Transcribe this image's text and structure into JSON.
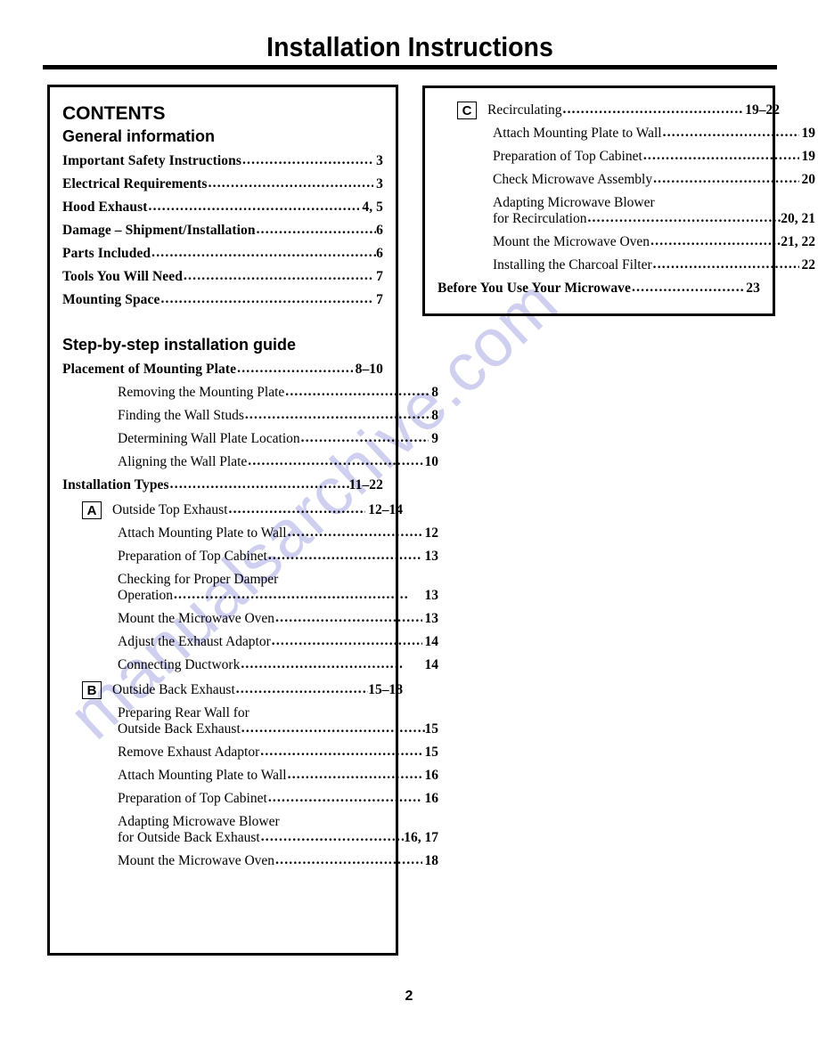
{
  "document": {
    "title": "Installation Instructions",
    "page_number": "2",
    "watermark": "manualsarchive.com"
  },
  "left_column": {
    "contents_heading": "CONTENTS",
    "general_information": {
      "heading": "General information",
      "entries": [
        {
          "label": "Important Safety Instructions",
          "page": "3"
        },
        {
          "label": "Electrical Requirements",
          "page": "3"
        },
        {
          "label": "Hood Exhaust",
          "page": "4, 5"
        },
        {
          "label": "Damage – Shipment/Installation",
          "page": "6"
        },
        {
          "label": "Parts Included",
          "page": "6"
        },
        {
          "label": "Tools You Will Need",
          "page": "7"
        },
        {
          "label": "Mounting Space",
          "page": "7"
        }
      ]
    },
    "step_by_step": {
      "heading": "Step-by-step installation guide",
      "placement": {
        "label": "Placement of Mounting Plate",
        "page": "8–10"
      },
      "placement_subentries": [
        {
          "label": "Removing the Mounting Plate",
          "page": "8"
        },
        {
          "label": "Finding the Wall Studs",
          "page": "8"
        },
        {
          "label": "Determining Wall Plate Location",
          "page": "9"
        },
        {
          "label": "Aligning the Wall Plate",
          "page": "10"
        }
      ],
      "installation_types": {
        "label": "Installation Types",
        "page": "11–22"
      },
      "type_a": {
        "badge": "A",
        "label": "Outside Top Exhaust",
        "page": "12–14",
        "subentries": [
          {
            "label": "Attach Mounting Plate to Wall",
            "page": "12"
          },
          {
            "label": "Preparation of Top Cabinet",
            "page": "13"
          },
          {
            "label_line1": "Checking for Proper Damper",
            "label": "Operation",
            "page": "13"
          },
          {
            "label": "Mount the Microwave Oven",
            "page": "13"
          },
          {
            "label": "Adjust the Exhaust Adaptor",
            "page": "14"
          },
          {
            "label": "Connecting Ductwork",
            "page": "14"
          }
        ]
      },
      "type_b": {
        "badge": "B",
        "label": "Outside Back Exhaust",
        "page": "15–18",
        "subentries": [
          {
            "label_line1": "Preparing Rear Wall for",
            "label": "Outside Back Exhaust",
            "page": "15"
          },
          {
            "label": "Remove Exhaust Adaptor",
            "page": "15"
          },
          {
            "label": "Attach Mounting Plate to Wall",
            "page": "16"
          },
          {
            "label": "Preparation of Top Cabinet",
            "page": "16"
          },
          {
            "label_line1": "Adapting Microwave Blower",
            "label": "for Outside Back Exhaust",
            "page": "16, 17"
          },
          {
            "label": "Mount the Microwave Oven",
            "page": "18"
          }
        ]
      }
    }
  },
  "right_column": {
    "type_c": {
      "badge": "C",
      "label": "Recirculating",
      "page": "19–22",
      "subentries": [
        {
          "label": "Attach Mounting Plate to Wall",
          "page": "19"
        },
        {
          "label": "Preparation of Top Cabinet",
          "page": "19"
        },
        {
          "label": "Check Microwave Assembly",
          "page": "20"
        },
        {
          "label_line1": "Adapting Microwave Blower",
          "label": "for Recirculation",
          "page": "20, 21"
        },
        {
          "label": "Mount the Microwave Oven",
          "page": "21, 22"
        },
        {
          "label": "Installing the Charcoal Filter",
          "page": "22"
        }
      ]
    },
    "before_you_use": {
      "label": "Before You Use Your Microwave",
      "page": "23"
    }
  }
}
